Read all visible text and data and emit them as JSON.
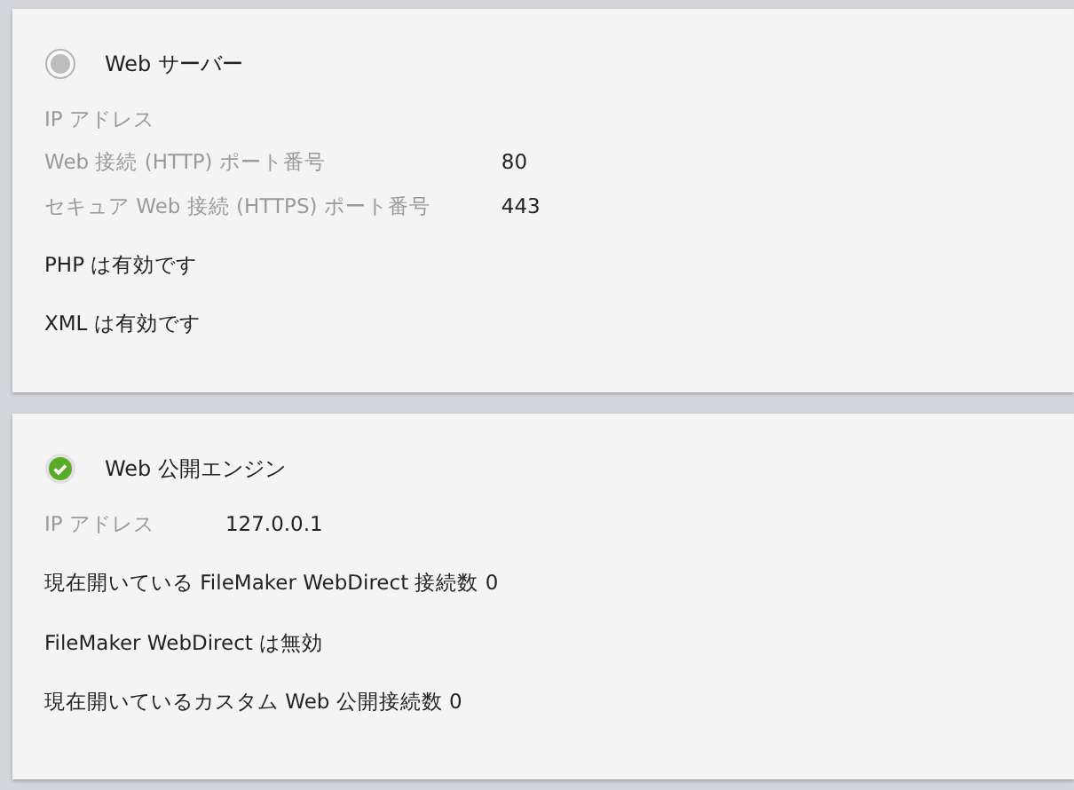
{
  "panels": [
    {
      "title": "Web サーバー",
      "enabled": false,
      "rows": [
        {
          "kind": "field",
          "label": "IP アドレス"
        },
        {
          "kind": "field",
          "label": "Web 接続 (HTTP) ポート番号",
          "value": "80"
        },
        {
          "kind": "field",
          "label": "セキュア Web 接続 (HTTPS) ポート番号",
          "value": "443"
        },
        {
          "kind": "text",
          "text": "PHP は有効です"
        },
        {
          "kind": "text",
          "text": "XML は有効です"
        }
      ]
    },
    {
      "title": "Web 公開エンジン",
      "enabled": true,
      "rows": [
        {
          "kind": "field",
          "label": "IP アドレス",
          "value": "127.0.0.1"
        },
        {
          "kind": "text",
          "text": "現在開いている FileMaker WebDirect 接続数 0"
        },
        {
          "kind": "text",
          "text": "FileMaker WebDirect は無効"
        },
        {
          "kind": "text",
          "text": "現在開いているカスタム Web 公開接続数 0"
        }
      ]
    }
  ]
}
